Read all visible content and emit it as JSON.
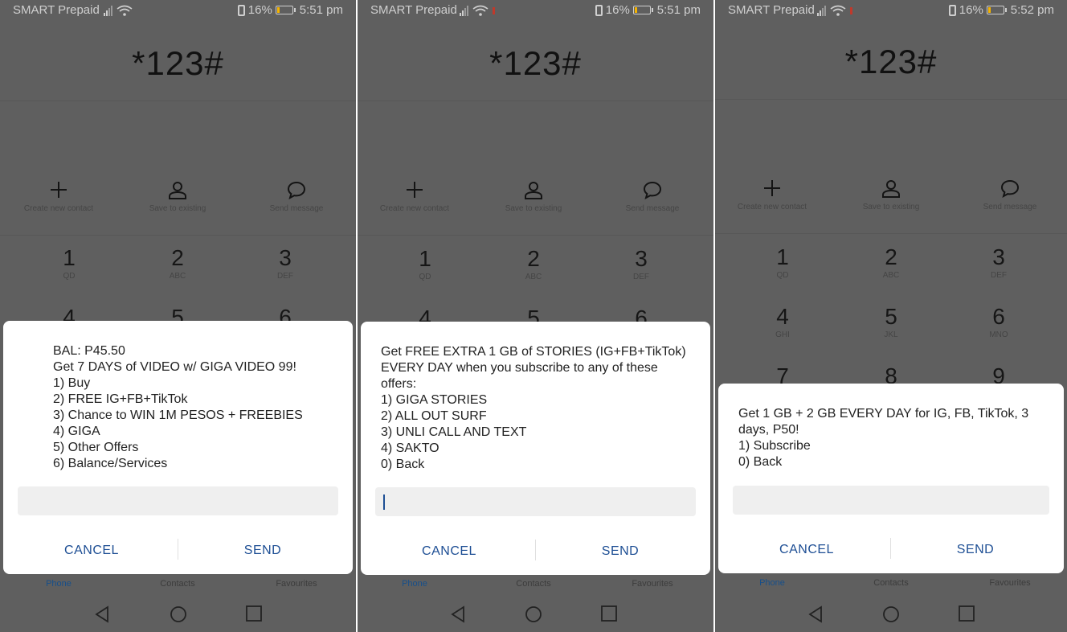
{
  "screens": [
    {
      "status": {
        "carrier": "SMART Prepaid",
        "battery": "16%",
        "time": "5:51 pm",
        "battery_level": 0.16
      },
      "dialed_number": "*123#",
      "actions": [
        "Create new contact",
        "Save to existing",
        "Send message"
      ],
      "keys": [
        {
          "digit": "1",
          "letters": "QD"
        },
        {
          "digit": "2",
          "letters": "ABC"
        },
        {
          "digit": "3",
          "letters": "DEF"
        },
        {
          "digit": "4",
          "letters": ""
        },
        {
          "digit": "5",
          "letters": ""
        },
        {
          "digit": "6",
          "letters": ""
        }
      ],
      "dialog": {
        "lines": [
          "BAL: P45.50",
          "Get 7 DAYS of VIDEO w/ GIGA VIDEO 99!",
          "1) Buy",
          "2) FREE IG+FB+TikTok",
          "3) Chance to WIN 1M PESOS + FREEBIES",
          "4) GIGA",
          "5) Other Offers",
          "6) Balance/Services"
        ],
        "input_value": "",
        "cancel": "CANCEL",
        "send": "SEND"
      },
      "tabs": [
        "Phone",
        "Contacts",
        "Favourites"
      ],
      "active_tab": "Phone"
    },
    {
      "status": {
        "carrier": "SMART Prepaid",
        "battery": "16%",
        "time": "5:51 pm",
        "battery_level": 0.16
      },
      "dialed_number": "*123#",
      "actions": [
        "Create new contact",
        "Save to existing",
        "Send message"
      ],
      "keys": [
        {
          "digit": "1",
          "letters": "QD"
        },
        {
          "digit": "2",
          "letters": "ABC"
        },
        {
          "digit": "3",
          "letters": "DEF"
        },
        {
          "digit": "4",
          "letters": ""
        },
        {
          "digit": "5",
          "letters": ""
        },
        {
          "digit": "6",
          "letters": ""
        }
      ],
      "dialog": {
        "lines": [
          "Get FREE EXTRA 1 GB of STORIES (IG+FB+TikTok)",
          "EVERY DAY when you subscribe to any of these",
          "offers:",
          "1) GIGA STORIES",
          "2) ALL OUT SURF",
          "3) UNLI CALL AND TEXT",
          "4) SAKTO",
          "0) Back"
        ],
        "input_value": "",
        "cancel": "CANCEL",
        "send": "SEND"
      },
      "tabs": [
        "Phone",
        "Contacts",
        "Favourites"
      ],
      "active_tab": "Phone"
    },
    {
      "status": {
        "carrier": "SMART Prepaid",
        "battery": "16%",
        "time": "5:52 pm",
        "battery_level": 0.16
      },
      "dialed_number": "*123#",
      "actions": [
        "Create new contact",
        "Save to existing",
        "Send message"
      ],
      "keys": [
        {
          "digit": "1",
          "letters": "QD"
        },
        {
          "digit": "2",
          "letters": "ABC"
        },
        {
          "digit": "3",
          "letters": "DEF"
        },
        {
          "digit": "4",
          "letters": "GHI"
        },
        {
          "digit": "5",
          "letters": "JKL"
        },
        {
          "digit": "6",
          "letters": "MNO"
        },
        {
          "digit": "7",
          "letters": ""
        },
        {
          "digit": "8",
          "letters": ""
        },
        {
          "digit": "9",
          "letters": ""
        }
      ],
      "dialog": {
        "lines": [
          "Get 1 GB + 2 GB EVERY DAY for IG, FB, TikTok, 3",
          "days, P50!",
          "1) Subscribe",
          "0) Back"
        ],
        "input_value": "",
        "cancel": "CANCEL",
        "send": "SEND"
      },
      "tabs": [
        "Phone",
        "Contacts",
        "Favourites"
      ],
      "active_tab": "Phone"
    }
  ]
}
